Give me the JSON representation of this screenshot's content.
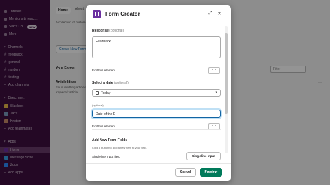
{
  "sidebar": {
    "items": [
      {
        "label": "Threads"
      },
      {
        "label": "Mentions & react..."
      },
      {
        "label": "Slack Co...",
        "badge": "NEW"
      },
      {
        "label": "More"
      },
      {
        "label": "Channels"
      },
      {
        "label": "feedback"
      },
      {
        "label": "general"
      },
      {
        "label": "random"
      },
      {
        "label": "testing"
      },
      {
        "label": "Add channels"
      },
      {
        "label": "Direct me..."
      },
      {
        "label": "Slackbot"
      },
      {
        "label": "Jack..."
      },
      {
        "label": "Kristen"
      },
      {
        "label": "Add teammates"
      },
      {
        "label": "Apps"
      },
      {
        "label": "Home"
      },
      {
        "label": "Message Sche..."
      },
      {
        "label": "Zoom"
      },
      {
        "label": "Add apps"
      }
    ]
  },
  "background": {
    "tab_home": "Home",
    "tab_about": "About",
    "info_text": "A collection of custom forms to collect feedback, run surveys and more, created by your team and shared in channels.",
    "create_button": "Create New Form",
    "section_title": "Your Forms",
    "filter_placeholder": "Filter",
    "item_title": "Article Ideas",
    "item_desc": "For submitting articles",
    "item_sub": "Keyword: article"
  },
  "modal": {
    "title": "Form Creator",
    "response_label": "Response",
    "response_optional": "(optional)",
    "response_value": "Feedback",
    "edit_label_1": "Edit this element",
    "dots_label": "···",
    "date_label": "Select a date",
    "date_optional": "(optional)",
    "date_value": "Today",
    "third_optional": "(optional)",
    "text_value": "Date of the E",
    "edit_label_2": "Edit this element",
    "add_fields_title": "Add New Form Fields",
    "add_fields_hint": "Click a button to add a new item to your field.",
    "singleline_label": "Singleline input field",
    "singleline_button": "Singleline input",
    "cancel_label": "Cancel",
    "preview_label": "Preview"
  },
  "colors": {
    "sidebar_bg": "#3f0e40",
    "primary_button": "#007a5a",
    "focus_border": "#1264a3",
    "app_icon": "#6b2fa0"
  }
}
